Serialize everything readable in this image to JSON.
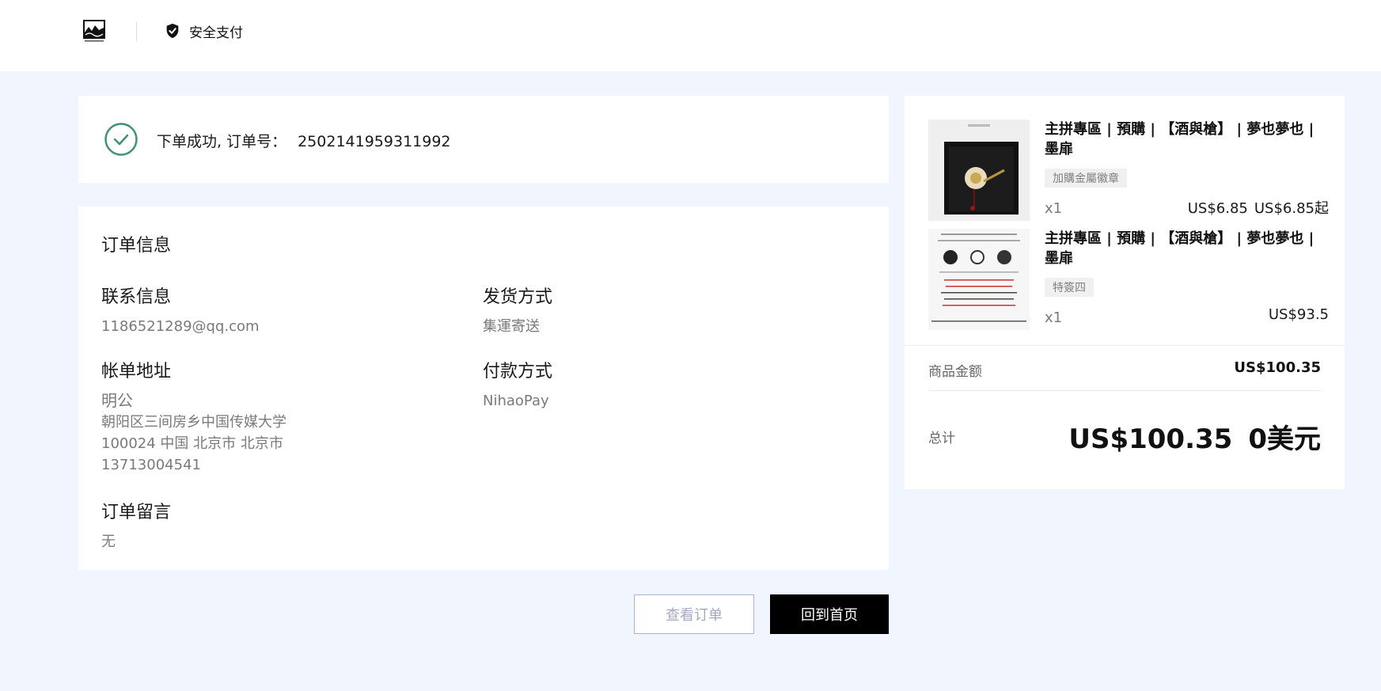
{
  "header": {
    "secure_label": "安全支付"
  },
  "success": {
    "message": "下单成功, 订单号：",
    "order_number": "2502141959311992"
  },
  "order_info": {
    "title": "订单信息",
    "contact": {
      "label": "联系信息",
      "value": "1186521289@qq.com"
    },
    "shipping": {
      "label": "发货方式",
      "value": "集運寄送"
    },
    "billing": {
      "label": "帐单地址",
      "name": "明公",
      "address_line": "朝阳区三间房乡中国传媒大学",
      "postal_line": "100024 中国 北京市 北京市",
      "phone": "13713004541"
    },
    "payment": {
      "label": "付款方式",
      "value": "NihaoPay"
    },
    "note": {
      "label": "订单留言",
      "value": "无"
    }
  },
  "buttons": {
    "view_order": "查看订单",
    "go_home": "回到首页"
  },
  "summary": {
    "items": [
      {
        "name": "主拼專區 | 預購 | 【酒與槍】 | 夢也夢也 | 墨扉",
        "variant": "加購金屬徽章",
        "qty": "x1",
        "price": "US$6.85",
        "price_from": "US$6.85起"
      },
      {
        "name": "主拼專區 | 預購 | 【酒與槍】 | 夢也夢也 | 墨扉",
        "variant": "特簽四",
        "qty": "x1",
        "price": "US$93.5"
      }
    ],
    "subtotal_label": "商品金额",
    "subtotal_value": "US$100.35",
    "total_label": "总计",
    "total_value": "US$100.35",
    "total_alt": "0美元"
  },
  "colors": {
    "page_bg": "#f1f5fd",
    "success_green": "#3f9470",
    "primary_button": "#000000"
  }
}
